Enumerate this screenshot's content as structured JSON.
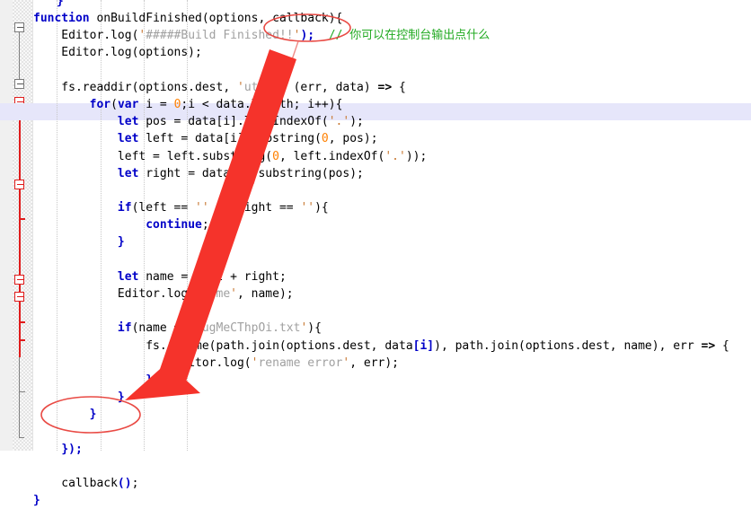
{
  "editor": {
    "current_line_highlight_color": "#e6e6fa",
    "gutter_background": "#f0f0f0",
    "lines": [
      {
        "indent": 2,
        "text": "}"
      },
      {
        "indent": 0,
        "text": "function onBuildFinished(options, callback){"
      },
      {
        "indent": 4,
        "text": "Editor.log('#####Build Finished!!');  // 你可以在控制台输出点什么"
      },
      {
        "indent": 4,
        "text": "Editor.log(options);"
      },
      {
        "indent": 0,
        "text": ""
      },
      {
        "indent": 4,
        "text": "fs.readdir(options.dest, 'utf8', (err, data) => {"
      },
      {
        "indent": 8,
        "text": "for(var i = 0;i < data.length; i++){"
      },
      {
        "indent": 12,
        "text": "let pos = data[i].lastIndexOf('.');"
      },
      {
        "indent": 12,
        "text": "let left = data[i].substring(0, pos);"
      },
      {
        "indent": 12,
        "text": "left = left.substring(0, left.indexOf('.'));"
      },
      {
        "indent": 12,
        "text": "let right = data[i].substring(pos);"
      },
      {
        "indent": 0,
        "text": ""
      },
      {
        "indent": 12,
        "text": "if(left == '' || right == ''){"
      },
      {
        "indent": 16,
        "text": "continue;"
      },
      {
        "indent": 12,
        "text": "}"
      },
      {
        "indent": 0,
        "text": ""
      },
      {
        "indent": 12,
        "text": "let name = left + right;"
      },
      {
        "indent": 12,
        "text": "Editor.log('name', name);"
      },
      {
        "indent": 0,
        "text": ""
      },
      {
        "indent": 12,
        "text": "if(name == 'ugMeCThpOi.txt'){"
      },
      {
        "indent": 16,
        "text": "fs.rename(path.join(options.dest, data[i]), path.join(options.dest, name), err => {"
      },
      {
        "indent": 20,
        "text": "Editor.log('rename error', err);"
      },
      {
        "indent": 16,
        "text": "});"
      },
      {
        "indent": 12,
        "text": "}"
      },
      {
        "indent": 8,
        "text": "}"
      },
      {
        "indent": 0,
        "text": ""
      },
      {
        "indent": 4,
        "text": "});"
      },
      {
        "indent": 0,
        "text": ""
      },
      {
        "indent": 4,
        "text": "callback();"
      },
      {
        "indent": 0,
        "text": "}"
      }
    ],
    "current_line_index": 7,
    "comment_text": "你可以在控制台输出点什么",
    "highlighted_tokens": {
      "callback_param": "callback",
      "callback_call": "callback();"
    }
  },
  "annotations": {
    "color": "#e8403a",
    "ellipse_top_label": "callback-param-ellipse",
    "ellipse_bottom_label": "callback-call-ellipse",
    "arrow_label": "annotation-arrow"
  }
}
